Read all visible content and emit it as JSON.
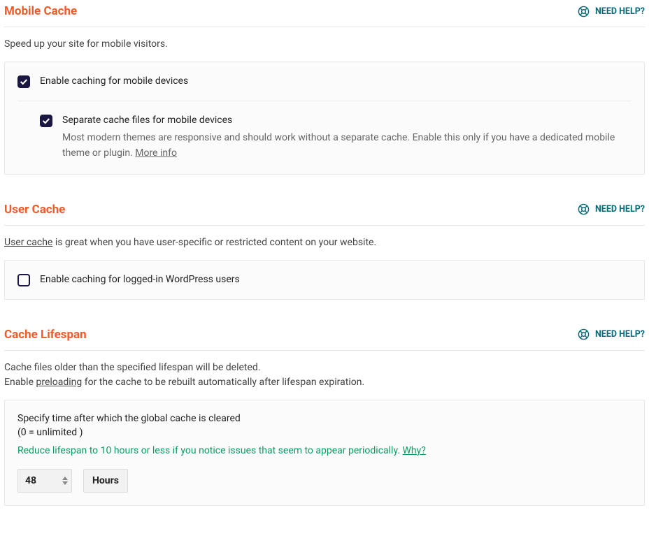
{
  "help_link": "NEED HELP?",
  "mobile_cache": {
    "title": "Mobile Cache",
    "description": "Speed up your site for mobile visitors.",
    "checkbox_enable": "Enable caching for mobile devices",
    "checkbox_separate": "Separate cache files for mobile devices",
    "help_text_prefix": "Most modern themes are responsive and should work without a separate cache. Enable this only if you have a dedicated mobile theme or plugin. ",
    "help_text_link": "More info"
  },
  "user_cache": {
    "title": "User Cache",
    "desc_link": "User cache",
    "desc_suffix": " is great when you have user-specific or restricted content on your website.",
    "checkbox_enable": "Enable caching for logged-in WordPress users"
  },
  "cache_lifespan": {
    "title": "Cache Lifespan",
    "desc_line1": "Cache files older than the specified lifespan will be deleted.",
    "desc_prefix": "Enable ",
    "desc_link": "preloading",
    "desc_suffix": " for the cache to be rebuilt automatically after lifespan expiration.",
    "label_line1": "Specify time after which the global cache is cleared",
    "label_line2": "(0 = unlimited )",
    "tip_prefix": "Reduce lifespan to 10 hours or less if you notice issues that seem to appear periodically. ",
    "tip_link": "Why?",
    "value": "48",
    "unit": "Hours"
  }
}
